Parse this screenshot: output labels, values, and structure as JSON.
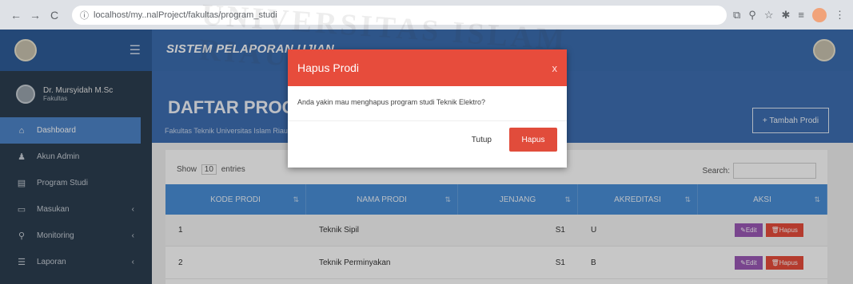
{
  "browser": {
    "back": "←",
    "forward": "→",
    "reload": "C",
    "url": "localhost/my..nalProject/fakultas/program_studi"
  },
  "app": {
    "title": "SISTEM PELAPORAN UJIAN"
  },
  "sidebar": {
    "user_name": "Dr. Mursyidah M.Sc",
    "user_role": "Fakultas",
    "items": [
      {
        "label": "Dashboard",
        "icon": "home-icon",
        "glyph": "⌂",
        "active": true,
        "caret": false
      },
      {
        "label": "Akun Admin",
        "icon": "user-icon",
        "glyph": "♟",
        "active": false,
        "caret": false
      },
      {
        "label": "Program Studi",
        "icon": "book-icon",
        "glyph": "▤",
        "active": false,
        "caret": false
      },
      {
        "label": "Masukan",
        "icon": "inbox-icon",
        "glyph": "▭",
        "active": false,
        "caret": true
      },
      {
        "label": "Monitoring",
        "icon": "search-icon",
        "glyph": "⚲",
        "active": false,
        "caret": true
      },
      {
        "label": "Laporan",
        "icon": "list-icon",
        "glyph": "☰",
        "active": false,
        "caret": true
      }
    ]
  },
  "page": {
    "title": "DAFTAR PROGRAM STUDI",
    "subtitle": "Fakultas Teknik Universitas Islam Riau",
    "add_button": "+ Tambah Prodi"
  },
  "table": {
    "show_label": "Show",
    "show_value": "10",
    "entries_label": "entries",
    "search_label": "Search:",
    "columns": [
      "KODE PRODI",
      "NAMA PRODI",
      "JENJANG",
      "AKREDITASI",
      "AKSI"
    ],
    "rows": [
      {
        "kode": "1",
        "nama": "Teknik Sipil",
        "jenjang": "S1",
        "akreditasi": "U",
        "edit": "✎Edit",
        "hapus": "🗑Hapus"
      },
      {
        "kode": "2",
        "nama": "Teknik Perminyakan",
        "jenjang": "S1",
        "akreditasi": "B",
        "edit": "✎Edit",
        "hapus": "🗑Hapus"
      }
    ]
  },
  "modal": {
    "title": "Hapus Prodi",
    "close": "x",
    "message": "Anda yakin mau menghapus program studi Teknik Elektro?",
    "cancel": "Tutup",
    "confirm": "Hapus"
  },
  "watermark": "UNIVERSITAS ISLAM RIAU",
  "colors": {
    "header": "#3c6db0",
    "sidebar": "#2c3e50",
    "active": "#4d84c8",
    "table_head": "#4a8fd8",
    "danger": "#e74c3c",
    "edit": "#9b59b6"
  }
}
